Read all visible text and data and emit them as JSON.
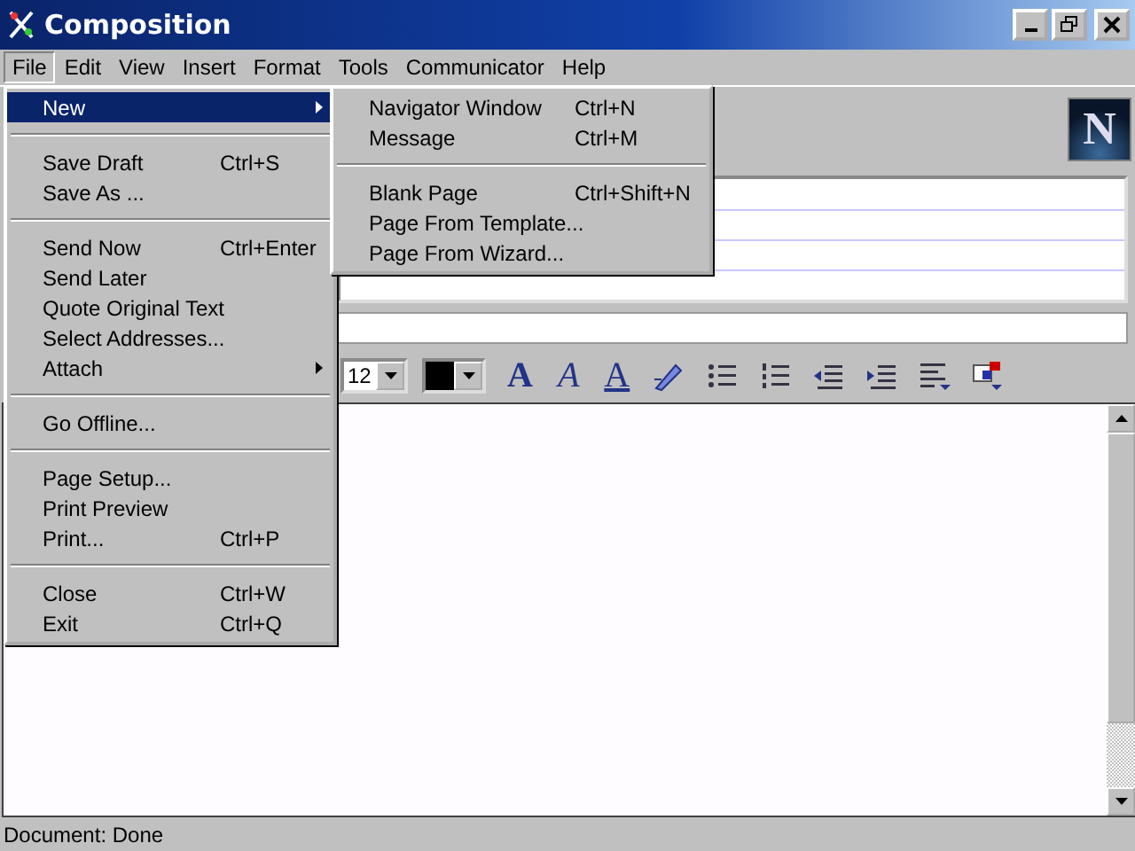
{
  "window": {
    "title": "Composition"
  },
  "menu_bar": [
    {
      "label": "File",
      "selected": true
    },
    {
      "label": "Edit",
      "selected": false
    },
    {
      "label": "View",
      "selected": false
    },
    {
      "label": "Insert",
      "selected": false
    },
    {
      "label": "Format",
      "selected": false
    },
    {
      "label": "Tools",
      "selected": false
    },
    {
      "label": "Communicator",
      "selected": false
    },
    {
      "label": "Help",
      "selected": false
    }
  ],
  "file_menu": {
    "groups": [
      [
        {
          "label": "New",
          "has_submenu": true,
          "selected": true
        }
      ],
      [
        {
          "label": "Save Draft",
          "shortcut": "Ctrl+S",
          "has_submenu": false,
          "selected": false
        },
        {
          "label": "Save As ...",
          "has_submenu": false,
          "selected": false
        }
      ],
      [
        {
          "label": "Send Now",
          "shortcut": "Ctrl+Enter",
          "has_submenu": false,
          "selected": false
        },
        {
          "label": "Send Later",
          "has_submenu": false,
          "selected": false
        },
        {
          "label": "Quote Original Text",
          "has_submenu": false,
          "selected": false
        },
        {
          "label": "Select Addresses...",
          "has_submenu": false,
          "selected": false
        },
        {
          "label": "Attach",
          "has_submenu": true,
          "selected": false
        }
      ],
      [
        {
          "label": "Go Offline...",
          "has_submenu": false,
          "selected": false
        }
      ],
      [
        {
          "label": "Page Setup...",
          "has_submenu": false,
          "selected": false
        },
        {
          "label": "Print Preview",
          "has_submenu": false,
          "selected": false
        },
        {
          "label": "Print...",
          "shortcut": "Ctrl+P",
          "has_submenu": false,
          "selected": false
        }
      ],
      [
        {
          "label": "Close",
          "shortcut": "Ctrl+W",
          "has_submenu": false,
          "selected": false
        },
        {
          "label": "Exit",
          "shortcut": "Ctrl+Q",
          "has_submenu": false,
          "selected": false
        }
      ]
    ]
  },
  "new_submenu": {
    "groups": [
      [
        {
          "label": "Navigator Window",
          "shortcut": "Ctrl+N",
          "selected": false
        },
        {
          "label": "Message",
          "shortcut": "Ctrl+M",
          "selected": false
        }
      ],
      [
        {
          "label": "Blank Page",
          "shortcut": "Ctrl+Shift+N",
          "selected": false
        },
        {
          "label": "Page From Template...",
          "selected": false
        },
        {
          "label": "Page From Wizard...",
          "selected": false
        }
      ]
    ]
  },
  "logo": {
    "letter": "N"
  },
  "format_toolbar": {
    "font_size": "12",
    "style_buttons": [
      {
        "kind": "bold",
        "glyph": "A"
      },
      {
        "kind": "italic",
        "glyph": "A"
      },
      {
        "kind": "underline",
        "glyph": "A"
      }
    ]
  },
  "status_bar": {
    "text": "Document: Done"
  }
}
